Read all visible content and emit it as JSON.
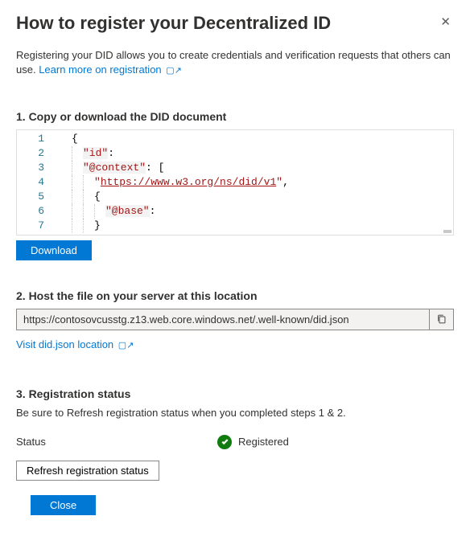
{
  "header": {
    "title": "How to register your Decentralized ID"
  },
  "intro": {
    "text": "Registering your DID allows you to create credentials and verification requests that others can use. ",
    "link_label": "Learn more on registration"
  },
  "step1": {
    "heading": "1. Copy or download the DID document",
    "download_label": "Download",
    "code": {
      "line1_brace": "{",
      "line2_key": "\"id\"",
      "line2_colon": ":",
      "line3_key": "\"@context\"",
      "line3_after": ": [",
      "line4_q1": "\"",
      "line4_url": "https://www.w3.org/ns/did/v1",
      "line4_q2": "\"",
      "line4_comma": ",",
      "line5_brace": "{",
      "line6_key": "\"@base\"",
      "line6_colon": ":",
      "line7_brace": "}"
    }
  },
  "step2": {
    "heading": "2. Host the file on your server at this location",
    "url": "https://contosovcusstg.z13.web.core.windows.net/.well-known/did.json",
    "visit_label": "Visit did.json location"
  },
  "step3": {
    "heading": "3. Registration status",
    "desc": "Be sure to Refresh registration status when you completed steps 1 & 2.",
    "status_label": "Status",
    "status_value": "Registered",
    "refresh_label": "Refresh registration status"
  },
  "footer": {
    "close_label": "Close"
  }
}
